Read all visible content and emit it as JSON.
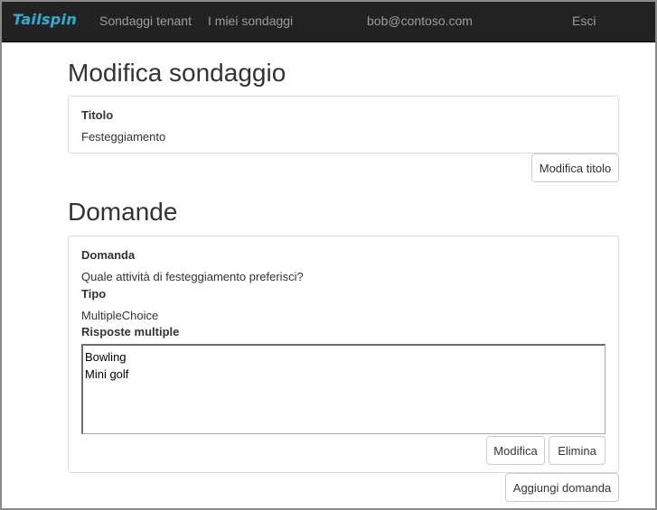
{
  "navbar": {
    "brand": "Tailspin",
    "tenant_surveys": "Sondaggi tenant",
    "my_surveys": "I miei sondaggi",
    "user_email": "bob@contoso.com",
    "logout": "Esci"
  },
  "page": {
    "title": "Modifica sondaggio"
  },
  "survey_title_panel": {
    "label": "Titolo",
    "value": "Festeggiamento",
    "edit_button": "Modifica titolo"
  },
  "questions_section": {
    "title": "Domande",
    "add_button": "Aggiungi domanda",
    "questions": [
      {
        "question_label": "Domanda",
        "question_text": "Quale attività di festeggiamento preferisci?",
        "type_label": "Tipo",
        "type_value": "MultipleChoice",
        "answers_label": "Risposte multiple",
        "answers": [
          "Bowling",
          "Mini golf"
        ],
        "edit_button": "Modifica",
        "delete_button": "Elimina"
      }
    ]
  },
  "colors": {
    "navbar_bg": "#222222",
    "nav_link": "#9d9d9d",
    "brand": "#3aa6c4",
    "panel_border": "#dddddd"
  }
}
